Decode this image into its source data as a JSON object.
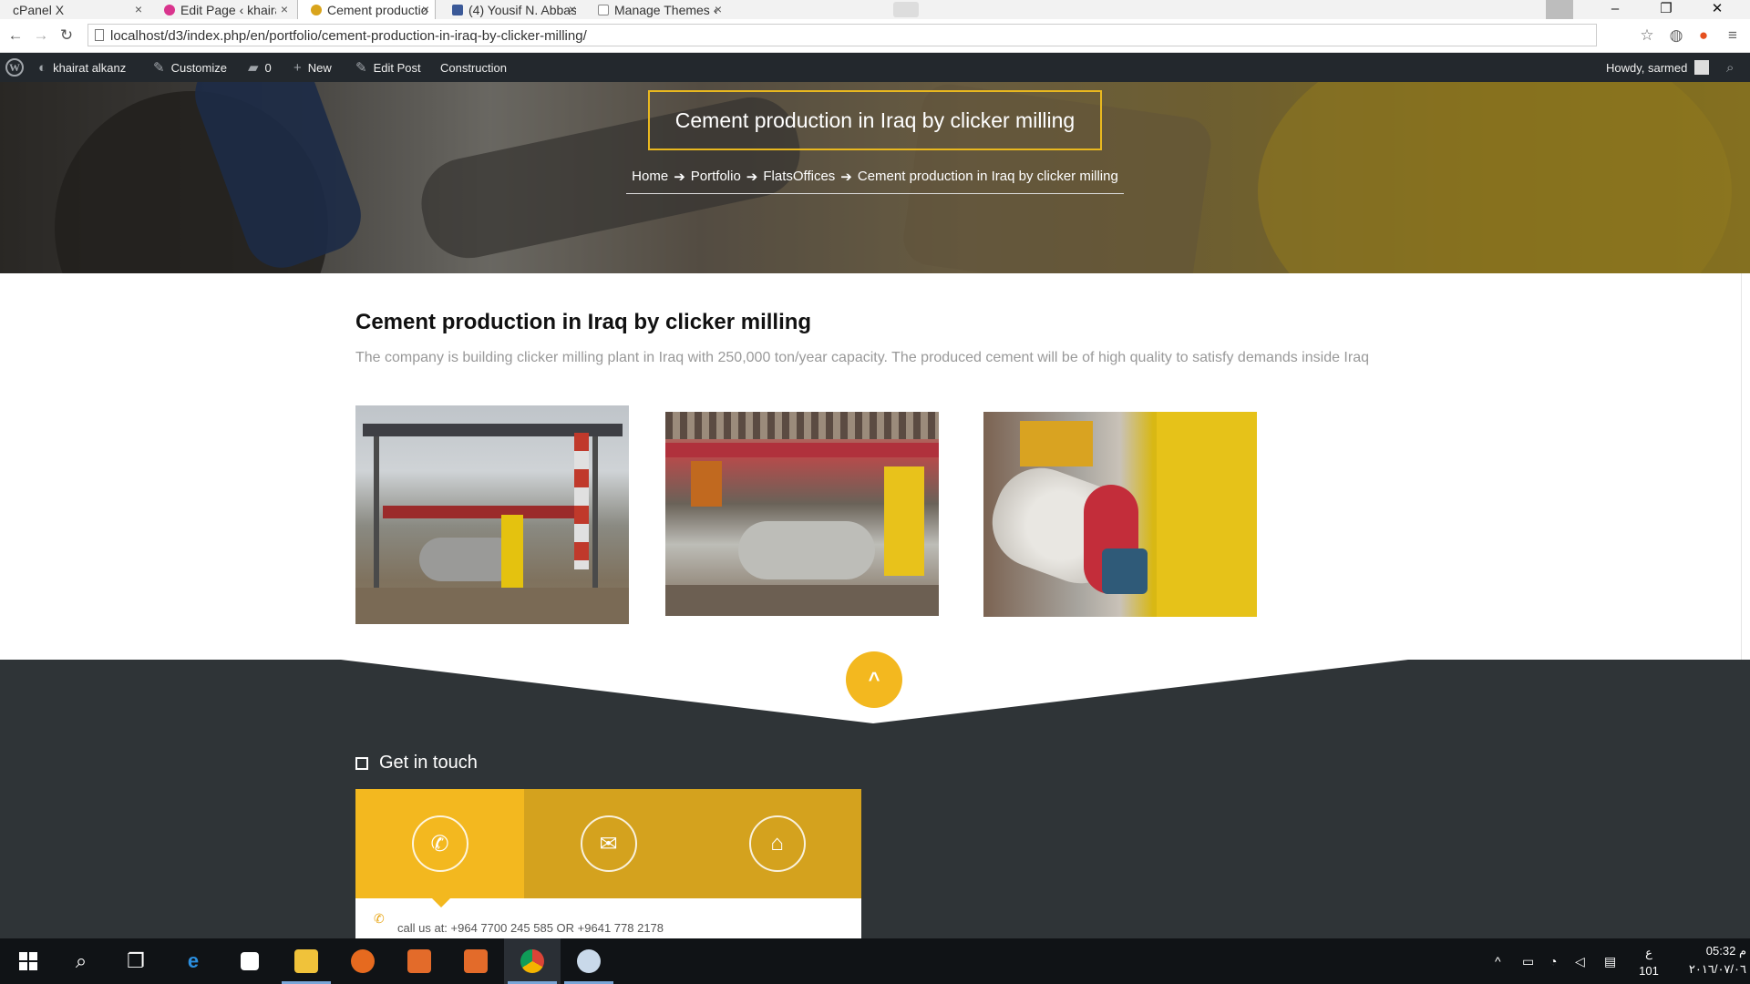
{
  "browser": {
    "tabs": [
      {
        "title": "cPanel X",
        "icon": "cpanel-icon",
        "color": "#e8782c"
      },
      {
        "title": "Edit Page ‹ khairat al",
        "icon": "wordpress-icon",
        "color": "#d9348d"
      },
      {
        "title": "Cement production",
        "icon": "site-icon",
        "color": "#d9a41c",
        "active": true
      },
      {
        "title": "(4) Yousif N. Abbas",
        "icon": "facebook-icon",
        "color": "#3b5998"
      },
      {
        "title": "Manage Themes ‹ kh",
        "icon": "page-icon",
        "color": "#888888"
      }
    ],
    "url": "localhost/d3/index.php/en/portfolio/cement-production-in-iraq-by-clicker-milling/"
  },
  "adminbar": {
    "site": "khairat alkanz",
    "customize": "Customize",
    "comments": "0",
    "new": "New",
    "edit_post": "Edit Post",
    "construction": "Construction",
    "howdy": "Howdy, sarmed"
  },
  "hero": {
    "title": "Cement production in Iraq by clicker milling",
    "breadcrumb": [
      "Home",
      "Portfolio",
      "FlatsOffices",
      "Cement production in Iraq by clicker milling"
    ],
    "sep": "➔"
  },
  "post": {
    "title": "Cement production in Iraq by clicker milling",
    "description": "The company is building clicker milling plant in Iraq with 250,000 ton/year capacity. The produced cement will be of high quality to satisfy demands inside Iraq"
  },
  "footer": {
    "heading": "Get in touch",
    "call_text": "call us at: +964 7700 245 585 OR +9641 778 2178",
    "panel_colors": [
      "#f3b81f",
      "#d4a21e",
      "#d4a21e"
    ],
    "to_top": "^"
  },
  "taskbar": {
    "time": "05:32 م",
    "date": "٢٠١٦/٠٧/٠٦",
    "lang_top": "ع",
    "lang_bottom": "101"
  }
}
